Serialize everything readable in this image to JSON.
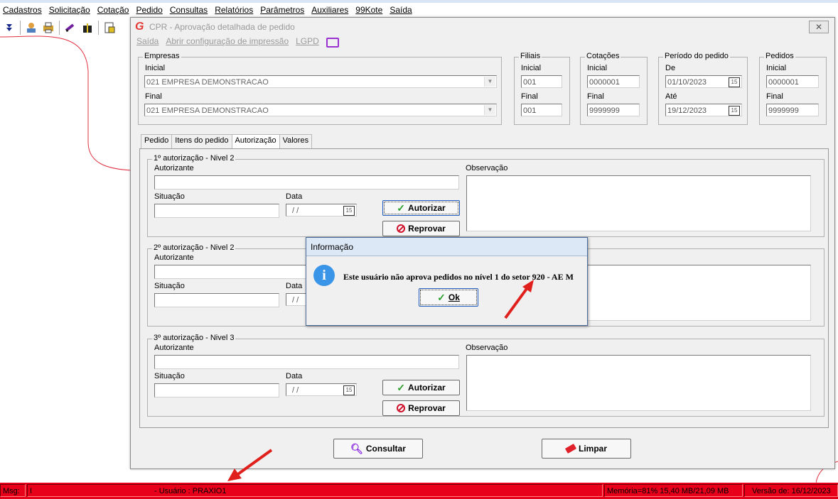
{
  "menubar": {
    "items": [
      "Cadastros",
      "Solicitação",
      "Cotação",
      "Pedido",
      "Consultas",
      "Relatórios",
      "Parâmetros",
      "Auxiliares",
      "99Kote",
      "Saída"
    ]
  },
  "window": {
    "title": "CPR - Aprovação detalhada de pedido",
    "menu": {
      "saida": "Saída",
      "abrir": "Abrir configuração de impressão",
      "lgpd": "LGPD"
    }
  },
  "filters": {
    "empresas": {
      "legend": "Empresas",
      "inicial_label": "Inicial",
      "inicial": "021 EMPRESA DEMONSTRACAO",
      "final_label": "Final",
      "final": "021 EMPRESA DEMONSTRACAO"
    },
    "filiais": {
      "legend": "Filiais",
      "inicial_label": "Inicial",
      "inicial": "001",
      "final_label": "Final",
      "final": "001"
    },
    "cotacoes": {
      "legend": "Cotações",
      "inicial_label": "Inicial",
      "inicial": "0000001",
      "final_label": "Final",
      "final": "9999999"
    },
    "periodo": {
      "legend": "Período do pedido",
      "de_label": "De",
      "de": "01/10/2023",
      "ate_label": "Até",
      "ate": "19/12/2023"
    },
    "pedidos": {
      "legend": "Pedidos",
      "inicial_label": "Inicial",
      "inicial": "0000001",
      "final_label": "Final",
      "final": "9999999"
    }
  },
  "tabs": [
    "Pedido",
    "Itens do pedido",
    "Autorização",
    "Valores"
  ],
  "active_tab": "Autorização",
  "authorizations": [
    {
      "legend": "1º autorização - Nivel 2",
      "autorizante_label": "Autorizante",
      "situacao_label": "Situação",
      "data_label": "Data",
      "data": "/ /",
      "observacao_label": "Observação",
      "autorizar": "Autorizar",
      "reprovar": "Reprovar"
    },
    {
      "legend": "2º autorização - Nivel 2",
      "autorizante_label": "Autorizante",
      "situacao_label": "Situação",
      "data_label": "Data",
      "data": "/ /"
    },
    {
      "legend": "3º autorização - Nivel 3",
      "autorizante_label": "Autorizante",
      "situacao_label": "Situação",
      "data_label": "Data",
      "data": "/ /",
      "observacao_label": "Observação",
      "autorizar": "Autorizar",
      "reprovar": "Reprovar"
    }
  ],
  "calendar_badge": "15",
  "footer_buttons": {
    "consultar": "Consultar",
    "limpar": "Limpar"
  },
  "dialog": {
    "title": "Informação",
    "message": "Este usuário não aprova pedidos no nível 1 do setor 920 - AE M",
    "ok": "Ok"
  },
  "statusbar": {
    "msg_label": "Msg:",
    "msg_value": "I",
    "usuario": "- Usuário : PRAXIO1",
    "memoria": "Memória=81% 15,40 MB/21,09 MB",
    "versao": "Versão de: 16/12/2023"
  },
  "colors": {
    "statusbar": "#e8001a",
    "accent_arrow": "#e0201c",
    "info_icon": "#3a95e8"
  }
}
